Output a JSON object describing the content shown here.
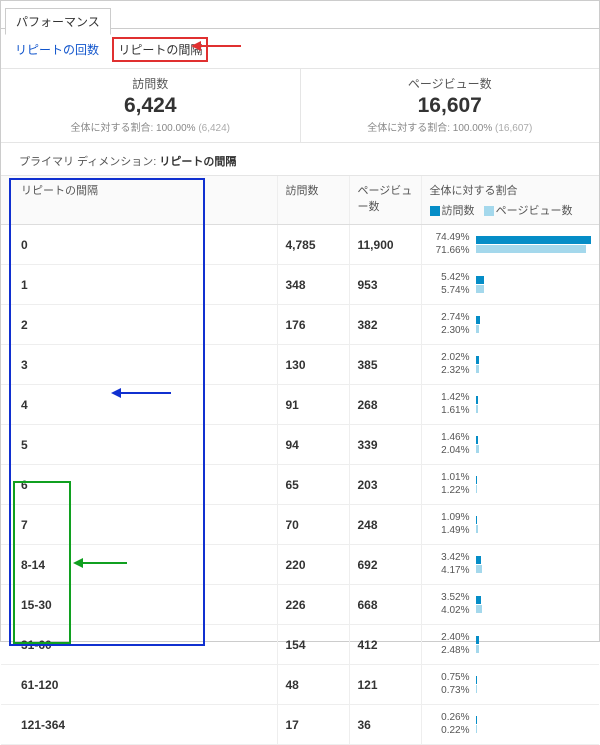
{
  "main_tab": "パフォーマンス",
  "subtabs": {
    "repeat_count": "リピートの回数",
    "repeat_interval": "リピートの間隔"
  },
  "summary": {
    "visits_label": "訪問数",
    "visits_value": "6,424",
    "visits_sub_prefix": "全体に対する割合:",
    "visits_sub_pct": "100.00%",
    "visits_sub_count": "(6,424)",
    "pv_label": "ページビュー数",
    "pv_value": "16,607",
    "pv_sub_prefix": "全体に対する割合:",
    "pv_sub_pct": "100.00%",
    "pv_sub_count": "(16,607)"
  },
  "primary_dimension_label": "プライマリ ディメンション:",
  "primary_dimension_value": "リピートの間隔",
  "headers": {
    "interval": "リピートの間隔",
    "visits": "訪問数",
    "pv": "ページビュー数",
    "ratio": "全体に対する割合",
    "legend_visits": "訪問数",
    "legend_pv": "ページビュー数"
  },
  "rows": [
    {
      "label": "0",
      "visits": "4,785",
      "pv": "11,900",
      "visits_pct": "74.49%",
      "pv_pct": "71.66%",
      "vw": 100,
      "pw": 96
    },
    {
      "label": "1",
      "visits": "348",
      "pv": "953",
      "visits_pct": "5.42%",
      "pv_pct": "5.74%",
      "vw": 7.3,
      "pw": 7.7
    },
    {
      "label": "2",
      "visits": "176",
      "pv": "382",
      "visits_pct": "2.74%",
      "pv_pct": "2.30%",
      "vw": 3.7,
      "pw": 3.1
    },
    {
      "label": "3",
      "visits": "130",
      "pv": "385",
      "visits_pct": "2.02%",
      "pv_pct": "2.32%",
      "vw": 2.7,
      "pw": 3.1
    },
    {
      "label": "4",
      "visits": "91",
      "pv": "268",
      "visits_pct": "1.42%",
      "pv_pct": "1.61%",
      "vw": 1.9,
      "pw": 2.2
    },
    {
      "label": "5",
      "visits": "94",
      "pv": "339",
      "visits_pct": "1.46%",
      "pv_pct": "2.04%",
      "vw": 2.0,
      "pw": 2.7
    },
    {
      "label": "6",
      "visits": "65",
      "pv": "203",
      "visits_pct": "1.01%",
      "pv_pct": "1.22%",
      "vw": 1.4,
      "pw": 1.6
    },
    {
      "label": "7",
      "visits": "70",
      "pv": "248",
      "visits_pct": "1.09%",
      "pv_pct": "1.49%",
      "vw": 1.5,
      "pw": 2.0
    },
    {
      "label": "8-14",
      "visits": "220",
      "pv": "692",
      "visits_pct": "3.42%",
      "pv_pct": "4.17%",
      "vw": 4.6,
      "pw": 5.6
    },
    {
      "label": "15-30",
      "visits": "226",
      "pv": "668",
      "visits_pct": "3.52%",
      "pv_pct": "4.02%",
      "vw": 4.7,
      "pw": 5.4
    },
    {
      "label": "31-60",
      "visits": "154",
      "pv": "412",
      "visits_pct": "2.40%",
      "pv_pct": "2.48%",
      "vw": 3.2,
      "pw": 3.3
    },
    {
      "label": "61-120",
      "visits": "48",
      "pv": "121",
      "visits_pct": "0.75%",
      "pv_pct": "0.73%",
      "vw": 1.0,
      "pw": 1.0
    },
    {
      "label": "121-364",
      "visits": "17",
      "pv": "36",
      "visits_pct": "0.26%",
      "pv_pct": "0.22%",
      "vw": 0.5,
      "pw": 0.4
    }
  ],
  "chart_data": {
    "type": "bar",
    "categories": [
      "0",
      "1",
      "2",
      "3",
      "4",
      "5",
      "6",
      "7",
      "8-14",
      "15-30",
      "31-60",
      "61-120",
      "121-364"
    ],
    "series": [
      {
        "name": "訪問数 %",
        "values": [
          74.49,
          5.42,
          2.74,
          2.02,
          1.42,
          1.46,
          1.01,
          1.09,
          3.42,
          3.52,
          2.4,
          0.75,
          0.26
        ]
      },
      {
        "name": "ページビュー数 %",
        "values": [
          71.66,
          5.74,
          2.3,
          2.32,
          1.61,
          2.04,
          1.22,
          1.49,
          4.17,
          4.02,
          2.48,
          0.73,
          0.22
        ]
      }
    ],
    "title": "全体に対する割合",
    "xlabel": "リピートの間隔",
    "ylabel": "%",
    "ylim": [
      0,
      100
    ]
  }
}
